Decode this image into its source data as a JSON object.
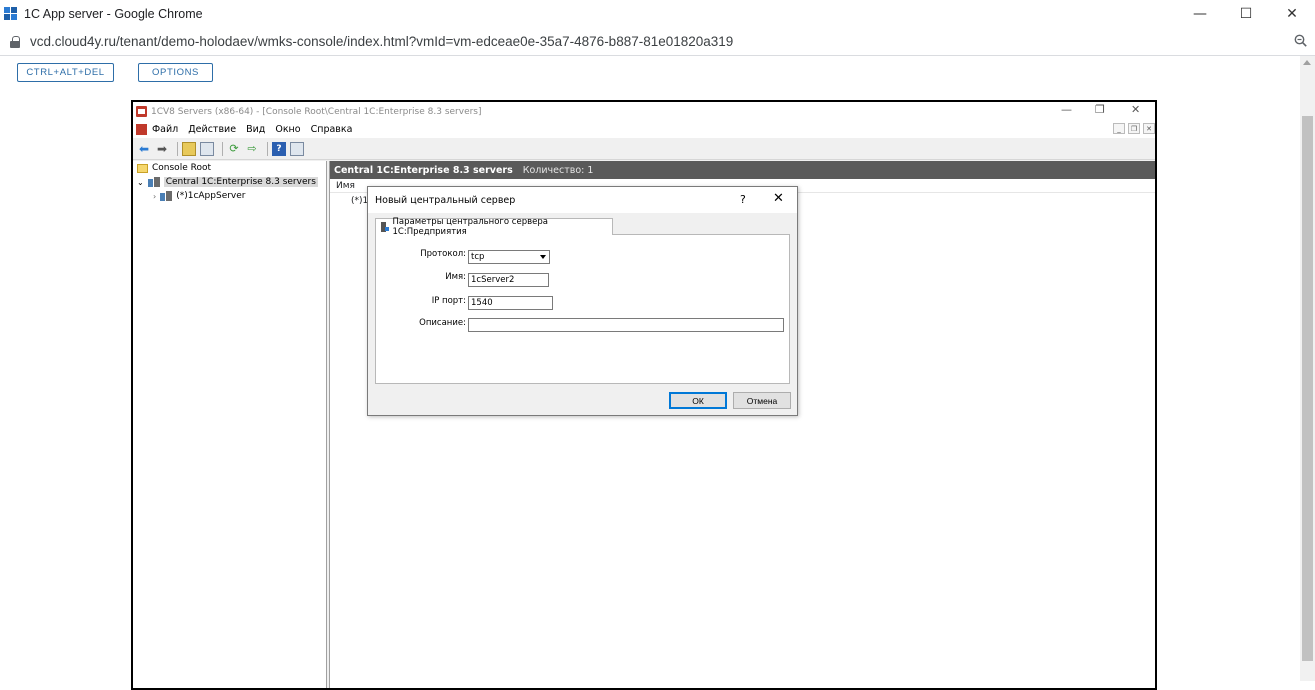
{
  "browser": {
    "title": "1C App server - Google Chrome",
    "url": "vcd.cloud4y.ru/tenant/demo-holodaev/wmks-console/index.html?vmId=vm-edceae0e-35a7-4876-b887-81e01820a319",
    "minimize": "—",
    "maximize": "☐",
    "close": "✕",
    "zoom_icon": "zoom-icon"
  },
  "console_toolbar": {
    "ctrl_alt_del": "CTRL+ALT+DEL",
    "options": "OPTIONS"
  },
  "mmc": {
    "title": "1CV8 Servers (x86-64) - [Console Root\\Central 1C:Enterprise 8.3 servers]",
    "menu": [
      "Файл",
      "Действие",
      "Вид",
      "Окно",
      "Справка"
    ],
    "tree": {
      "root": "Console Root",
      "central": "Central 1C:Enterprise 8.3 servers",
      "server": "(*)1cAppServer"
    },
    "right_pane": {
      "header_title": "Central 1C:Enterprise 8.3 servers",
      "header_count": "Количество: 1",
      "column_name": "Имя",
      "item": "(*)1c"
    }
  },
  "dialog": {
    "title": "Новый центральный сервер",
    "help": "?",
    "close": "✕",
    "tab": "Параметры центрального сервера 1С:Предприятия",
    "fields": {
      "protocol_label": "Протокол:",
      "protocol_value": "tcp",
      "name_label": "Имя:",
      "name_value": "1cServer2",
      "port_label": "IP порт:",
      "port_value": "1540",
      "description_label": "Описание:",
      "description_value": ""
    },
    "ok": "ОК",
    "cancel": "Отмена"
  },
  "colors": {
    "accent": "#2e6ea8",
    "header_dark": "#5a5a5a",
    "ok_border": "#0078d7"
  }
}
